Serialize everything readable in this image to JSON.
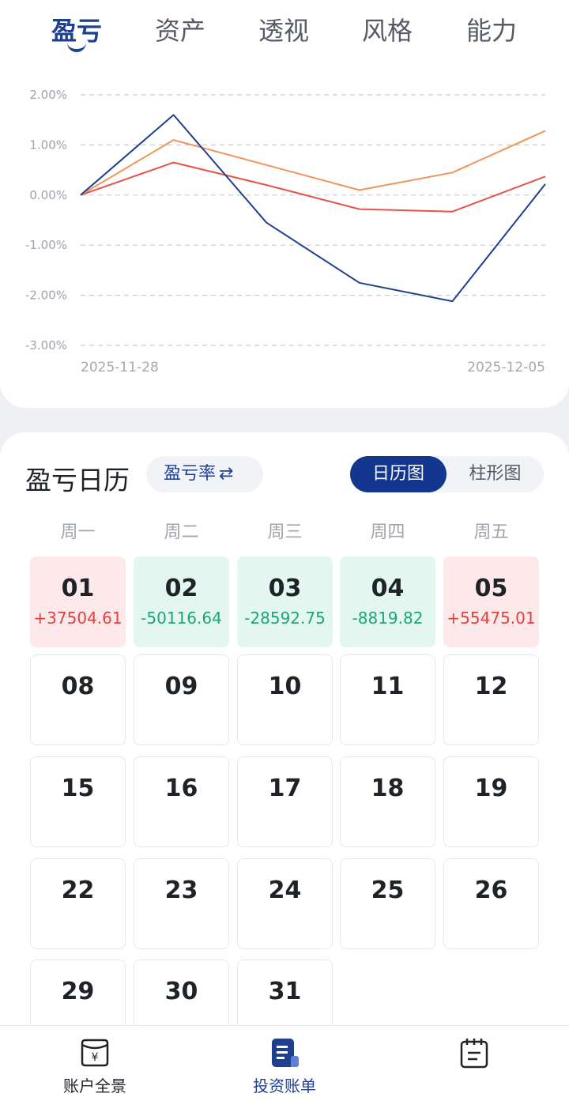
{
  "tabs": [
    "盈亏",
    "资产",
    "透视",
    "风格",
    "能力"
  ],
  "chart_data": {
    "type": "line",
    "x": [
      "2025-11-28",
      "2025-12-01",
      "2025-12-02",
      "2025-12-03",
      "2025-12-04",
      "2025-12-05"
    ],
    "x_tick_labels": [
      "2025-11-28",
      "2025-12-05"
    ],
    "y_tick_labels": [
      "2.00%",
      "1.00%",
      "0.00%",
      "-1.00%",
      "-2.00%",
      "-3.00%"
    ],
    "ylim": [
      -3.0,
      2.0
    ],
    "grid": "horizontal dashed",
    "series": [
      {
        "values": [
          0.0,
          1.6,
          -0.55,
          -1.75,
          -2.12,
          0.22
        ],
        "color": "#1f3f8f"
      },
      {
        "values": [
          0.0,
          1.1,
          0.6,
          0.1,
          0.45,
          1.28
        ],
        "color": "#f0945a"
      },
      {
        "values": [
          0.0,
          0.65,
          0.2,
          -0.28,
          -0.33,
          0.37
        ],
        "color": "#e5534b"
      }
    ]
  },
  "calendar": {
    "title": "盈亏日历",
    "rate_toggle": "盈亏率",
    "rate_icon": "⇄",
    "view_calendar": "日历图",
    "view_bar": "柱形图",
    "weekdays": [
      "周一",
      "周二",
      "周三",
      "周四",
      "周五"
    ],
    "days": [
      {
        "day": "01",
        "amount": "+37504.61",
        "status": "pos"
      },
      {
        "day": "02",
        "amount": "-50116.64",
        "status": "neg"
      },
      {
        "day": "03",
        "amount": "-28592.75",
        "status": "neg"
      },
      {
        "day": "04",
        "amount": "-8819.82",
        "status": "neg"
      },
      {
        "day": "05",
        "amount": "+55475.01",
        "status": "pos"
      },
      {
        "day": "08"
      },
      {
        "day": "09"
      },
      {
        "day": "10"
      },
      {
        "day": "11"
      },
      {
        "day": "12"
      },
      {
        "day": "15"
      },
      {
        "day": "16"
      },
      {
        "day": "17"
      },
      {
        "day": "18"
      },
      {
        "day": "19"
      },
      {
        "day": "22"
      },
      {
        "day": "23"
      },
      {
        "day": "24"
      },
      {
        "day": "25"
      },
      {
        "day": "26"
      },
      {
        "day": "29"
      },
      {
        "day": "30"
      },
      {
        "day": "31"
      }
    ]
  },
  "bottom_nav": {
    "items": [
      {
        "label": "账户全景",
        "icon": "wallet-yen-icon"
      },
      {
        "label": "投资账单",
        "icon": "bill-document-icon"
      },
      {
        "label": "",
        "icon": "calendar-clipboard-icon"
      }
    ]
  }
}
